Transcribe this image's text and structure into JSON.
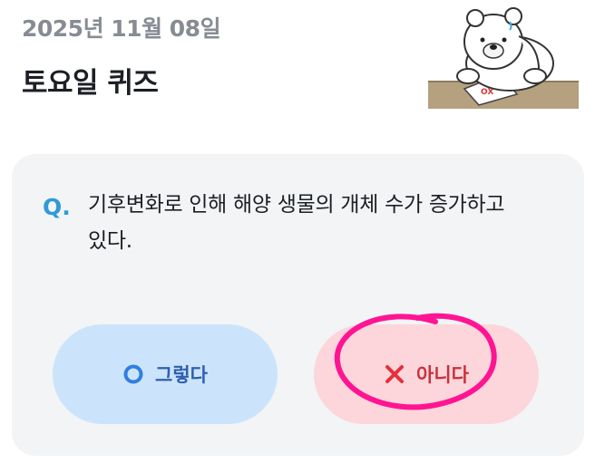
{
  "header": {
    "date": "2025년 11월 08일",
    "title": "토요일 퀴즈"
  },
  "mascot": {
    "icon": "polar-bear-thinking-icon",
    "card_text": "OX"
  },
  "quiz": {
    "q_label": "Q.",
    "question": "기후변화로 인해 해양 생물의 개체 수가 증가하고 있다."
  },
  "answers": {
    "yes": {
      "label": "그렇다",
      "icon": "circle-o-icon",
      "color": "#2f7fe0"
    },
    "no": {
      "label": "아니다",
      "icon": "x-cross-icon",
      "color": "#e5303d"
    }
  },
  "annotation": {
    "color": "#ff1493"
  }
}
